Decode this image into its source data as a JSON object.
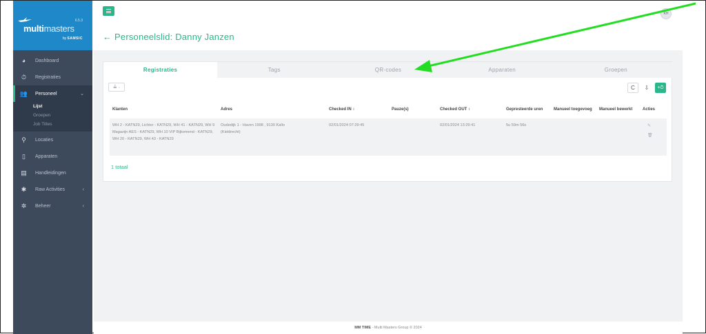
{
  "brand": {
    "name_bold": "multi",
    "name_thin": "masters",
    "version": "6.5.3",
    "by": "by",
    "by_brand": "SAMSIC"
  },
  "sidebar": {
    "items": [
      {
        "label": "Dashboard",
        "icon": "dashboard-icon"
      },
      {
        "label": "Registraties",
        "icon": "stopwatch-icon"
      },
      {
        "label": "Personeel",
        "icon": "users-icon",
        "caret": "⌄"
      },
      {
        "label": "Locaties",
        "icon": "map-pin-icon"
      },
      {
        "label": "Apparaten",
        "icon": "tablet-icon"
      },
      {
        "label": "Handleidingen",
        "icon": "book-icon"
      },
      {
        "label": "Raw Activities",
        "icon": "bug-icon",
        "caret": "‹"
      },
      {
        "label": "Beheer",
        "icon": "gear-icon",
        "caret": "‹"
      }
    ],
    "sub_items": [
      "Lijst",
      "Groepen",
      "Job Titles"
    ]
  },
  "header": {
    "avatar_initials": "KH",
    "back_arrow": "←",
    "page_title": "Personeelslid: Danny Janzen"
  },
  "tabs": [
    "Registraties",
    "Tags",
    "QR-codes",
    "Apparaten",
    "Groepen"
  ],
  "toolbar": {
    "filter_label": "≟ ·",
    "refresh": "C",
    "export": "⇩",
    "add": "+⏱"
  },
  "table": {
    "columns": [
      "Klanten",
      "Adres",
      "Checked IN ↕",
      "Pauze(s)",
      "Checked OUT ↕",
      "Gepresteerde uren",
      "Manueel toegevoeg",
      "Manueel bewerkt",
      "Acties"
    ],
    "rows": [
      {
        "klanten": "WH 2 - KATN29, Lichter - KATN29, WH 41 - KATN29, WH 9 Magazijn AES - KATN29, WH 10 VIP Bijkomend - KATN29, WH 20 - KATN29, WH 43 - KATN29",
        "adres": "Oudedijk 1 - Haven 1998 , 9130 Kallo (Kieldrecht)",
        "checked_in": "02/01/2024 07:29:45",
        "pauze": "",
        "checked_out": "02/01/2024 13:29:41",
        "uren": "5u 59m 56s",
        "manueel_toegevoegd": "",
        "manueel_bewerkt": ""
      }
    ],
    "total": "1 totaal"
  },
  "footer": {
    "brand": "MM TIME",
    "text": " - Multi Masters Group © 2024"
  },
  "colors": {
    "accent": "#2ab58a",
    "sidebar": "#3d4a5c",
    "logo_bg": "#1f88c8",
    "annotation_arrow": "#22dd22"
  }
}
